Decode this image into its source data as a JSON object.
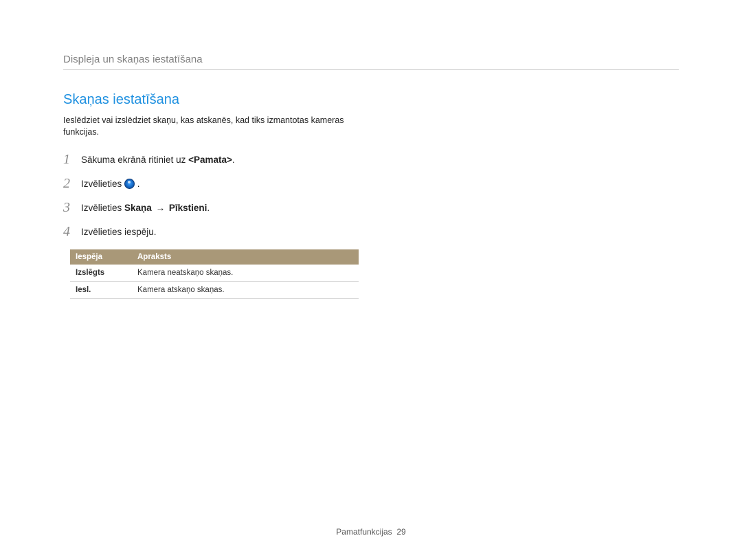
{
  "header": {
    "title": "Displeja un skaņas iestatīšana"
  },
  "section": {
    "title": "Skaņas iestatīšana",
    "description": "Ieslēdziet vai izslēdziet skaņu, kas atskanēs, kad tiks izmantotas kameras funkcijas."
  },
  "steps": {
    "s1": {
      "num": "1",
      "pre": "Sākuma ekrānā ritiniet uz ",
      "bold": "<Pamata>",
      "post": "."
    },
    "s2": {
      "num": "2",
      "pre": "Izvēlieties ",
      "post": " ."
    },
    "s3": {
      "num": "3",
      "pre": "Izvēlieties ",
      "bold1": "Skaņa",
      "arrow": "→",
      "bold2": "Pīkstieni",
      "post": "."
    },
    "s4": {
      "num": "4",
      "text": "Izvēlieties iespēju."
    }
  },
  "table": {
    "headers": {
      "option": "Iespēja",
      "description": "Apraksts"
    },
    "rows": [
      {
        "option": "Izslēgts",
        "description": "Kamera neatskaņo skaņas."
      },
      {
        "option": "Iesl.",
        "description": "Kamera atskaņo skaņas."
      }
    ]
  },
  "footer": {
    "section": "Pamatfunkcijas",
    "page": "29"
  }
}
